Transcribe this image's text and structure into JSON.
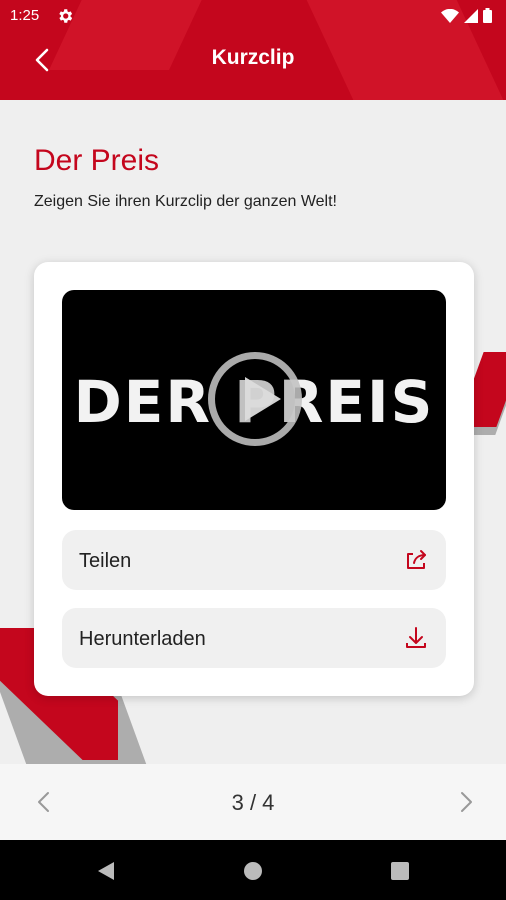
{
  "status_bar": {
    "time": "1:25"
  },
  "toolbar": {
    "title": "Kurzclip"
  },
  "header": {
    "title": "Der Preis",
    "subtitle": "Zeigen Sie ihren Kurzclip der ganzen Welt!"
  },
  "video": {
    "overlay_text": "DER PREIS"
  },
  "actions": {
    "share_label": "Teilen",
    "download_label": "Herunterladen"
  },
  "pagination": {
    "indicator": "3 / 4"
  },
  "colors": {
    "brand_red": "#c4061d"
  },
  "icons": [
    "back-arrow-icon",
    "share-icon",
    "download-icon",
    "chevron-left-icon",
    "chevron-right-icon",
    "play-icon"
  ]
}
